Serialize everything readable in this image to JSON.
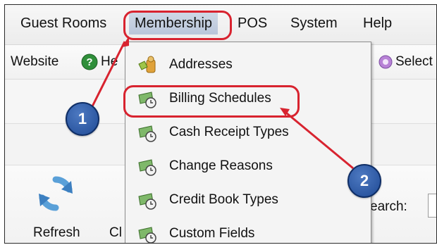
{
  "menubar": {
    "items": [
      "Guest Rooms",
      "Membership",
      "POS",
      "System",
      "Help"
    ]
  },
  "toolbar": {
    "website_label": "Website",
    "help_label": "He",
    "select_label": "Select"
  },
  "membership_menu": {
    "items": [
      {
        "label": "Addresses",
        "icon": "addresses-icon"
      },
      {
        "label": "Billing Schedules",
        "icon": "billing-icon"
      },
      {
        "label": "Cash Receipt Types",
        "icon": "billing-icon"
      },
      {
        "label": "Change Reasons",
        "icon": "billing-icon"
      },
      {
        "label": "Credit Book Types",
        "icon": "billing-icon"
      },
      {
        "label": "Custom Fields",
        "icon": "billing-icon"
      }
    ]
  },
  "lower_toolbar": {
    "refresh_label": "Refresh",
    "next_label": "Cl",
    "search_label": "earch:"
  },
  "callouts": [
    {
      "number": "1"
    },
    {
      "number": "2"
    }
  ],
  "colors": {
    "callout_red": "#d8232f",
    "badge_blue": "#1f4a95",
    "menu_highlight": "#c3cfe1"
  }
}
